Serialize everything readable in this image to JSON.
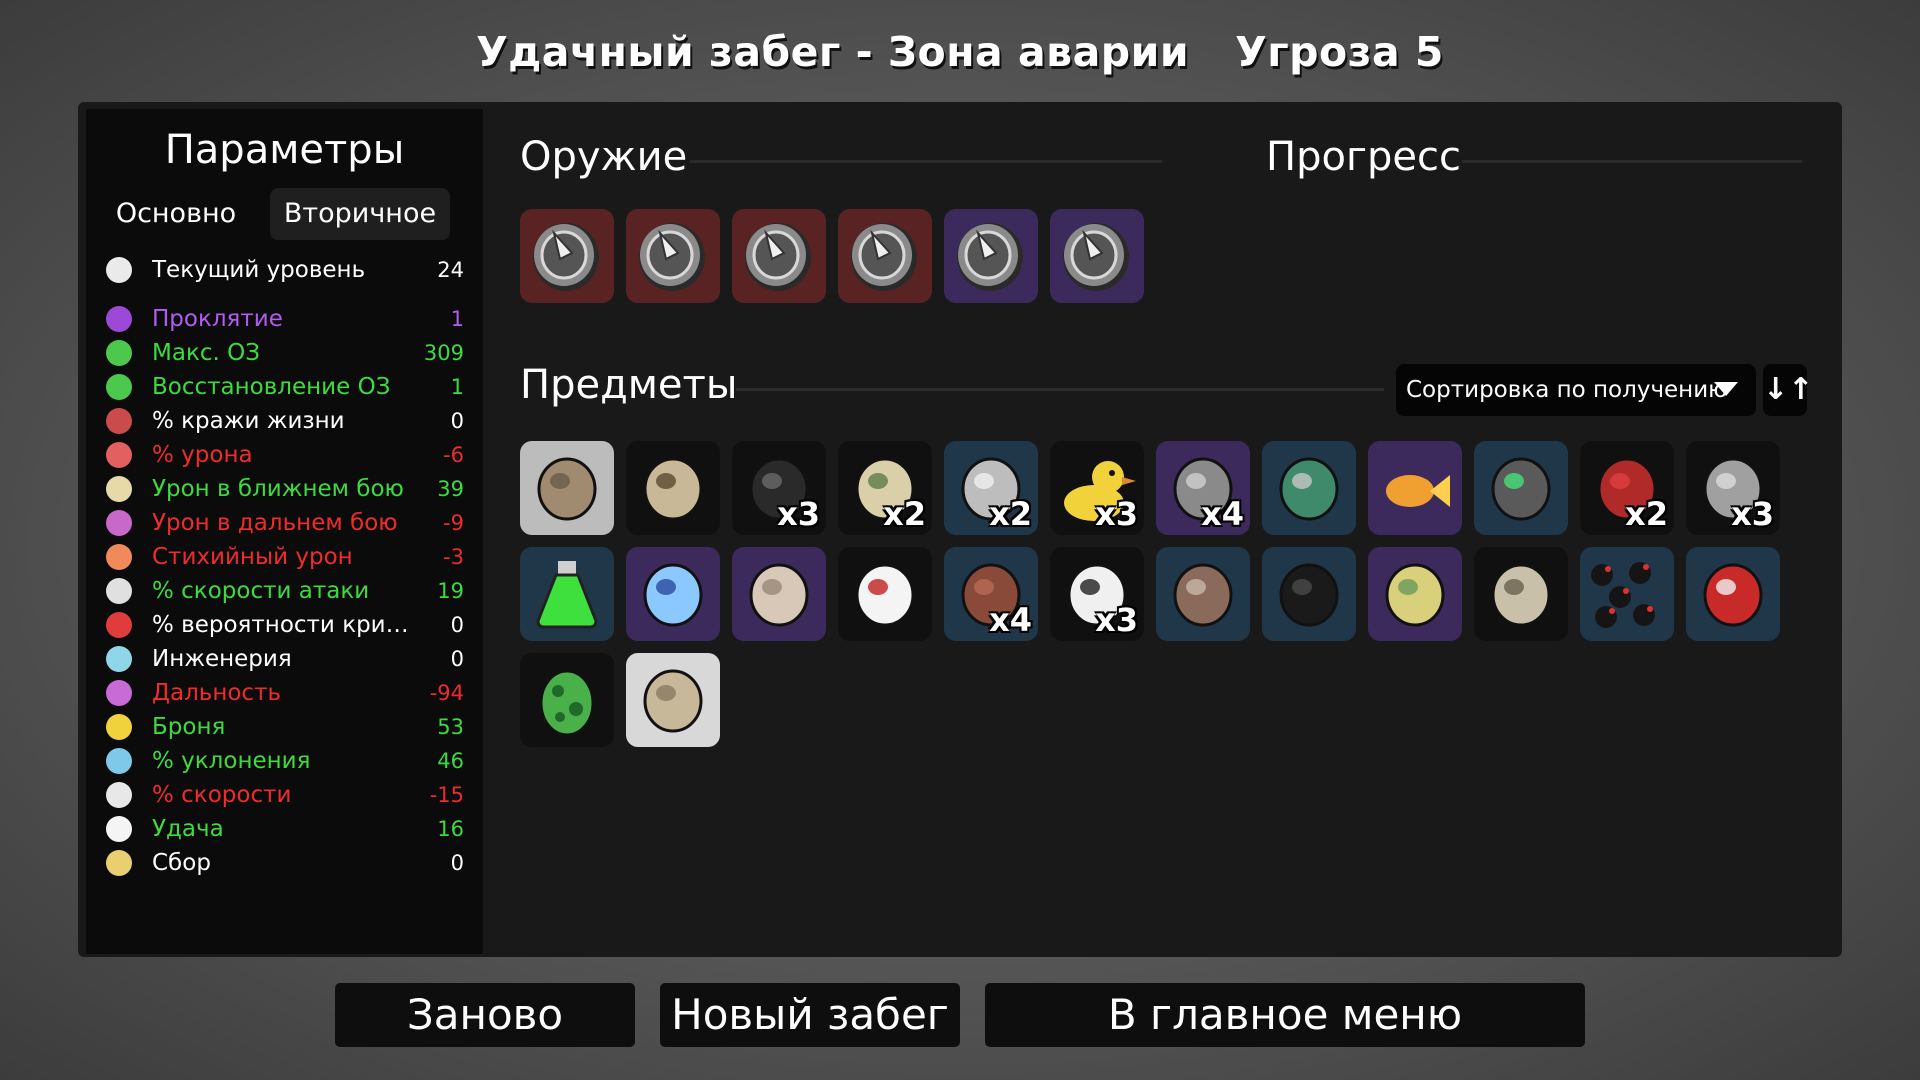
{
  "header": {
    "run_title": "Удачный забег - Зона аварии",
    "danger": "Угроза 5"
  },
  "stats_panel": {
    "title": "Параметры",
    "tabs": [
      "Основно",
      "Вторичное"
    ],
    "active_tab": "Вторичное",
    "rows": [
      {
        "icon": "level-up-icon",
        "label": "Текущий уровень",
        "value": "24",
        "color": "#ffffff",
        "vcolor": "#ffffff",
        "ibg": "#eaeaea"
      },
      {
        "icon": "curse-eye-icon",
        "label": "Проклятие",
        "value": "1",
        "color": "#b15cf0",
        "vcolor": "#b15cf0",
        "ibg": "#9b49d6"
      },
      {
        "icon": "heart-icon",
        "label": "Макс. ОЗ",
        "value": "309",
        "color": "#3ddb3d",
        "vcolor": "#3ddb3d",
        "ibg": "#4cc94c"
      },
      {
        "icon": "heart-plus-icon",
        "label": "Восстановление ОЗ",
        "value": "1",
        "color": "#3ddb3d",
        "vcolor": "#3ddb3d",
        "ibg": "#4cc94c"
      },
      {
        "icon": "fangs-icon",
        "label": "% кражи жизни",
        "value": "0",
        "color": "#ffffff",
        "vcolor": "#ffffff",
        "ibg": "#c94b4b"
      },
      {
        "icon": "muscle-icon",
        "label": "% урона",
        "value": "-6",
        "color": "#ef2b2b",
        "vcolor": "#ef2b2b",
        "ibg": "#e26060"
      },
      {
        "icon": "sword-icon",
        "label": "Урон в ближнем бою",
        "value": "39",
        "color": "#3ddb3d",
        "vcolor": "#3ddb3d",
        "ibg": "#e8d9a8"
      },
      {
        "icon": "bow-icon",
        "label": "Урон в дальнем бою",
        "value": "-9",
        "color": "#ef2b2b",
        "vcolor": "#ef2b2b",
        "ibg": "#c868c8"
      },
      {
        "icon": "flame-icon",
        "label": "Стихийный урон",
        "value": "-3",
        "color": "#ef2b2b",
        "vcolor": "#ef2b2b",
        "ibg": "#f08a5a"
      },
      {
        "icon": "hourglass-icon",
        "label": "% скорости атаки",
        "value": "19",
        "color": "#3ddb3d",
        "vcolor": "#3ddb3d",
        "ibg": "#e0e0e0"
      },
      {
        "icon": "crit-burst-icon",
        "label": "% вероятности крит. удара",
        "value": "0",
        "color": "#ffffff",
        "vcolor": "#ffffff",
        "ibg": "#e03c3c"
      },
      {
        "icon": "wrench-icon",
        "label": "Инженерия",
        "value": "0",
        "color": "#ffffff",
        "vcolor": "#ffffff",
        "ibg": "#8fd7e8"
      },
      {
        "icon": "range-signal-icon",
        "label": "Дальность",
        "value": "-94",
        "color": "#ef2b2b",
        "vcolor": "#ef2b2b",
        "ibg": "#c86bd6"
      },
      {
        "icon": "shield-icon",
        "label": "Броня",
        "value": "53",
        "color": "#3ddb3d",
        "vcolor": "#3ddb3d",
        "ibg": "#f0d23c"
      },
      {
        "icon": "dodge-wind-icon",
        "label": "% уклонения",
        "value": "46",
        "color": "#3ddb3d",
        "vcolor": "#3ddb3d",
        "ibg": "#7ec8ea"
      },
      {
        "icon": "boot-icon",
        "label": "% скорости",
        "value": "-15",
        "color": "#ef2b2b",
        "vcolor": "#ef2b2b",
        "ibg": "#e8e8e8"
      },
      {
        "icon": "dice-icon",
        "label": "Удача",
        "value": "16",
        "color": "#3ddb3d",
        "vcolor": "#3ddb3d",
        "ibg": "#f4f4f4"
      },
      {
        "icon": "harvest-wheat-icon",
        "label": "Сбор",
        "value": "0",
        "color": "#ffffff",
        "vcolor": "#ffffff",
        "ibg": "#e8d070"
      }
    ]
  },
  "weapons": {
    "title": "Оружие",
    "slots": [
      {
        "icon": "spiked-shield-icon",
        "tier_color": "#5a2323"
      },
      {
        "icon": "spiked-shield-icon",
        "tier_color": "#5a2323"
      },
      {
        "icon": "spiked-shield-icon",
        "tier_color": "#5a2323"
      },
      {
        "icon": "spiked-shield-icon",
        "tier_color": "#5a2323"
      },
      {
        "icon": "spiked-shield-icon",
        "tier_color": "#3d2a5c"
      },
      {
        "icon": "spiked-shield-icon",
        "tier_color": "#3d2a5c"
      }
    ]
  },
  "progress": {
    "title": "Прогресс"
  },
  "items": {
    "title": "Предметы",
    "sort_label": "Сортировка по получению",
    "sort_order_icon": "↓↑",
    "slots": [
      {
        "icon": "potato-icon",
        "tier_color": "#bcbcbc",
        "qty": ""
      },
      {
        "icon": "turret-icon",
        "tier_color": "#101010",
        "qty": ""
      },
      {
        "icon": "helmet-icon",
        "tier_color": "#101010",
        "qty": "x3"
      },
      {
        "icon": "banknote-icon",
        "tier_color": "#101010",
        "qty": "x2"
      },
      {
        "icon": "blade-icon",
        "tier_color": "#20374a",
        "qty": "x2"
      },
      {
        "icon": "rubber-duck-icon",
        "tier_color": "#101010",
        "qty": "x3"
      },
      {
        "icon": "robot-head-icon",
        "tier_color": "#3d2a5c",
        "qty": "x4"
      },
      {
        "icon": "mortar-icon",
        "tier_color": "#20374a",
        "qty": ""
      },
      {
        "icon": "goldfish-icon",
        "tier_color": "#3d2a5c",
        "qty": ""
      },
      {
        "icon": "slime-sleeve-icon",
        "tier_color": "#20374a",
        "qty": ""
      },
      {
        "icon": "red-scar-icon",
        "tier_color": "#101010",
        "qty": "x2"
      },
      {
        "icon": "steel-helmet-icon",
        "tier_color": "#101010",
        "qty": "x3"
      },
      {
        "icon": "potion-icon",
        "tier_color": "#20374a",
        "qty": ""
      },
      {
        "icon": "alien-eye-icon",
        "tier_color": "#3d2a5c",
        "qty": ""
      },
      {
        "icon": "tardigrade-icon",
        "tier_color": "#3d2a5c",
        "qty": ""
      },
      {
        "icon": "fang-mouth-icon",
        "tier_color": "#101010",
        "qty": ""
      },
      {
        "icon": "sausage-icon",
        "tier_color": "#20374a",
        "qty": "x4"
      },
      {
        "icon": "ninja-icon",
        "tier_color": "#101010",
        "qty": "x3"
      },
      {
        "icon": "leather-vest-icon",
        "tier_color": "#20374a",
        "qty": ""
      },
      {
        "icon": "black-belt-icon",
        "tier_color": "#20374a",
        "qty": ""
      },
      {
        "icon": "lemon-mold-icon",
        "tier_color": "#3d2a5c",
        "qty": ""
      },
      {
        "icon": "snail-icon",
        "tier_color": "#101010",
        "qty": ""
      },
      {
        "icon": "bullets-icon",
        "tier_color": "#20374a",
        "qty": ""
      },
      {
        "icon": "ketchup-icon",
        "tier_color": "#20374a",
        "qty": ""
      },
      {
        "icon": "green-egg-icon",
        "tier_color": "#101010",
        "qty": ""
      },
      {
        "icon": "rock-icon",
        "tier_color": "#d8d8d8",
        "qty": ""
      }
    ]
  },
  "buttons": {
    "restart": "Заново",
    "new_run": "Новый забег",
    "main_menu": "В главное меню"
  }
}
